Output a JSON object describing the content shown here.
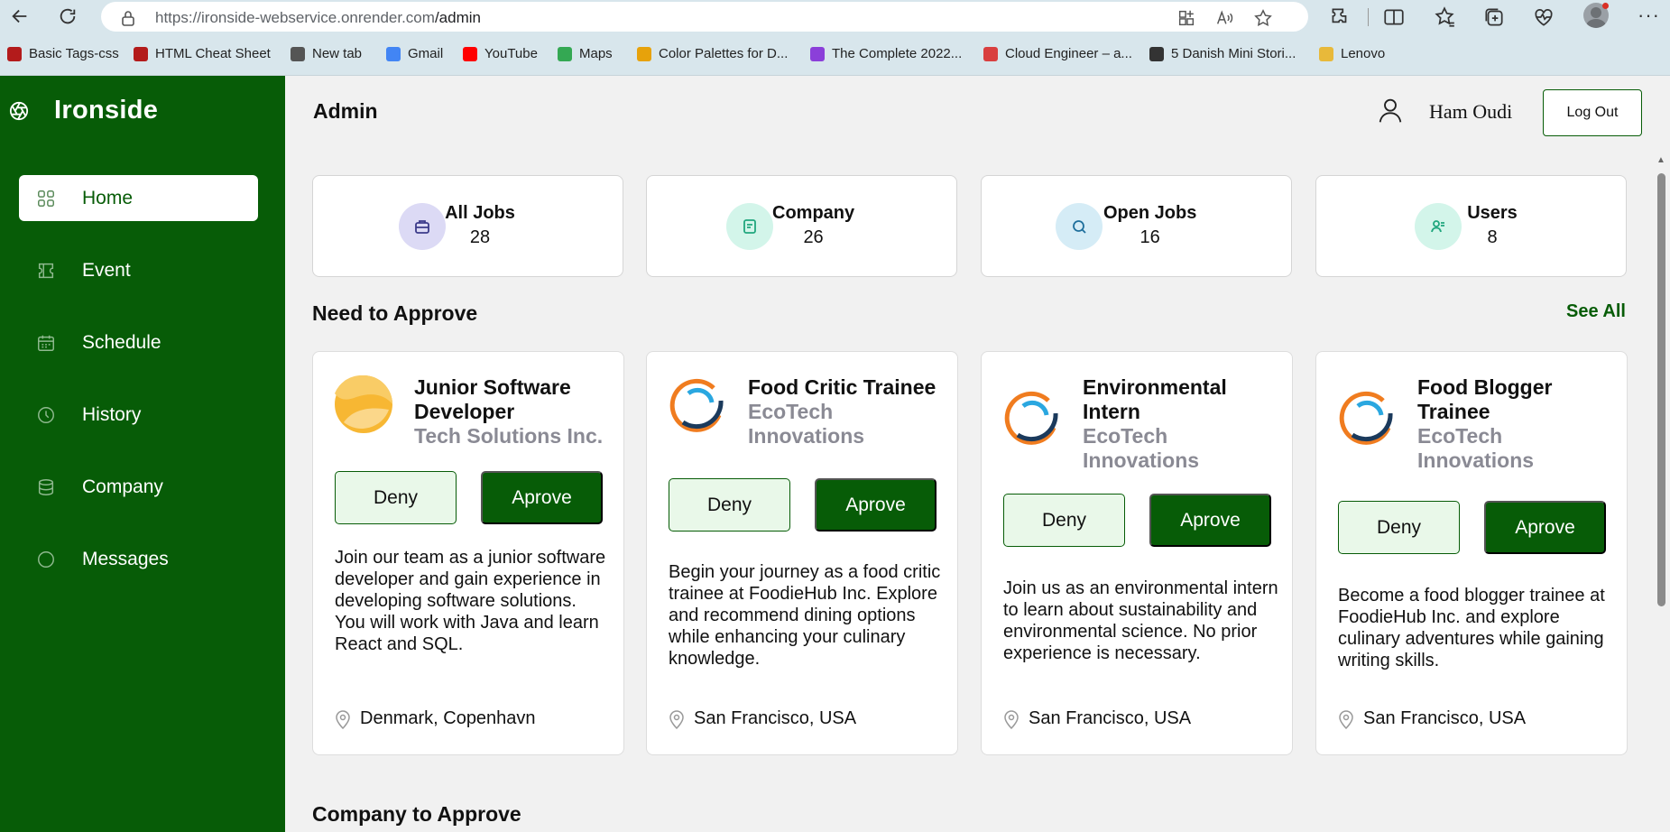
{
  "browser": {
    "url_host": "https://ironside-webservice.onrender.com",
    "url_path": "/admin",
    "bookmarks": [
      {
        "label": "Basic Tags-css",
        "color": "#b31b1b"
      },
      {
        "label": "HTML Cheat Sheet",
        "color": "#b31b1b"
      },
      {
        "label": "New tab",
        "color": "#555555"
      },
      {
        "label": "Gmail",
        "color": "#4285f4"
      },
      {
        "label": "YouTube",
        "color": "#ff0000"
      },
      {
        "label": "Maps",
        "color": "#34a853"
      },
      {
        "label": "Color Palettes for D...",
        "color": "#e7a20b"
      },
      {
        "label": "The Complete 2022...",
        "color": "#8b3fd9"
      },
      {
        "label": "Cloud Engineer – a...",
        "color": "#d93f3f"
      },
      {
        "label": "5 Danish Mini Stori...",
        "color": "#333333"
      },
      {
        "label": "Lenovo",
        "color": "#e8b93a"
      }
    ]
  },
  "app": {
    "brand": "Ironside",
    "accent": "#075c07",
    "sidebar": [
      {
        "label": "Home",
        "icon": "grid-icon",
        "active": true
      },
      {
        "label": "Event",
        "icon": "ticket-icon",
        "active": false
      },
      {
        "label": "Schedule",
        "icon": "calendar-icon",
        "active": false
      },
      {
        "label": "History",
        "icon": "clock-icon",
        "active": false
      },
      {
        "label": "Company",
        "icon": "database-icon",
        "active": false
      },
      {
        "label": "Messages",
        "icon": "chat-icon",
        "active": false
      }
    ]
  },
  "header": {
    "title": "Admin",
    "user_name": "Ham Oudi",
    "logout_label": "Log Out"
  },
  "stats": [
    {
      "label": "All Jobs",
      "value": "28",
      "icon": "briefcase-icon",
      "bg": "#dcdaf5",
      "fg": "#3b3a8a"
    },
    {
      "label": "Company",
      "value": "26",
      "icon": "document-icon",
      "bg": "#d3f5ea",
      "fg": "#20a77e"
    },
    {
      "label": "Open Jobs",
      "value": "16",
      "icon": "search-icon",
      "bg": "#d5ecf6",
      "fg": "#1f6f9c"
    },
    {
      "label": "Users",
      "value": "8",
      "icon": "users-icon",
      "bg": "#d3f5ea",
      "fg": "#20a77e"
    }
  ],
  "approve_section": {
    "title": "Need to Approve",
    "see_all": "See All",
    "deny_label": "Deny",
    "approve_label": "Aprove",
    "cards": [
      {
        "title": "Junior Software Developer",
        "company": "Tech Solutions Inc.",
        "logo": "sun-logo",
        "description": "Join our team as a junior software developer and gain experience in developing software solutions. You will work with Java and learn React and SQL.",
        "location": "Denmark, Copenhavn"
      },
      {
        "title": "Food Critic Trainee",
        "company": "EcoTech Innovations",
        "logo": "ring-logo",
        "description": "Begin your journey as a food critic trainee at FoodieHub Inc. Explore and recommend dining options while enhancing your culinary knowledge.",
        "location": "San Francisco, USA"
      },
      {
        "title": "Environmental Intern",
        "company": "EcoTech Innovations",
        "logo": "ring-logo",
        "description": "Join us as an environmental intern to learn about sustainability and environmental science. No prior experience is necessary.",
        "location": "San Francisco, USA"
      },
      {
        "title": "Food Blogger Trainee",
        "company": "EcoTech Innovations",
        "logo": "ring-logo",
        "description": "Become a food blogger trainee at FoodieHub Inc. and explore culinary adventures while gaining writing skills.",
        "location": "San Francisco, USA"
      }
    ]
  },
  "company_section": {
    "title": "Company to Approve"
  }
}
